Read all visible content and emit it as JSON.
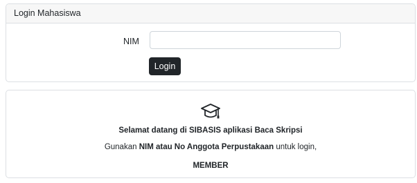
{
  "login_card": {
    "header_title": "Login Mahasiswa",
    "nim_label": "NIM",
    "nim_value": "",
    "nim_placeholder": "",
    "login_button": "Login"
  },
  "welcome_card": {
    "icon": "graduation-cap-icon",
    "title": "Selamat datang di SIBASIS aplikasi Baca Skripsi",
    "desc_prefix": "Gunakan ",
    "desc_bold": "NIM atau No Anggota Perpustakaan",
    "desc_suffix": " untuk login,",
    "member_text": "MEMBER"
  },
  "colors": {
    "button_bg": "#212529",
    "card_border": "#dcdfe3",
    "header_bg": "#f7f7f7"
  }
}
